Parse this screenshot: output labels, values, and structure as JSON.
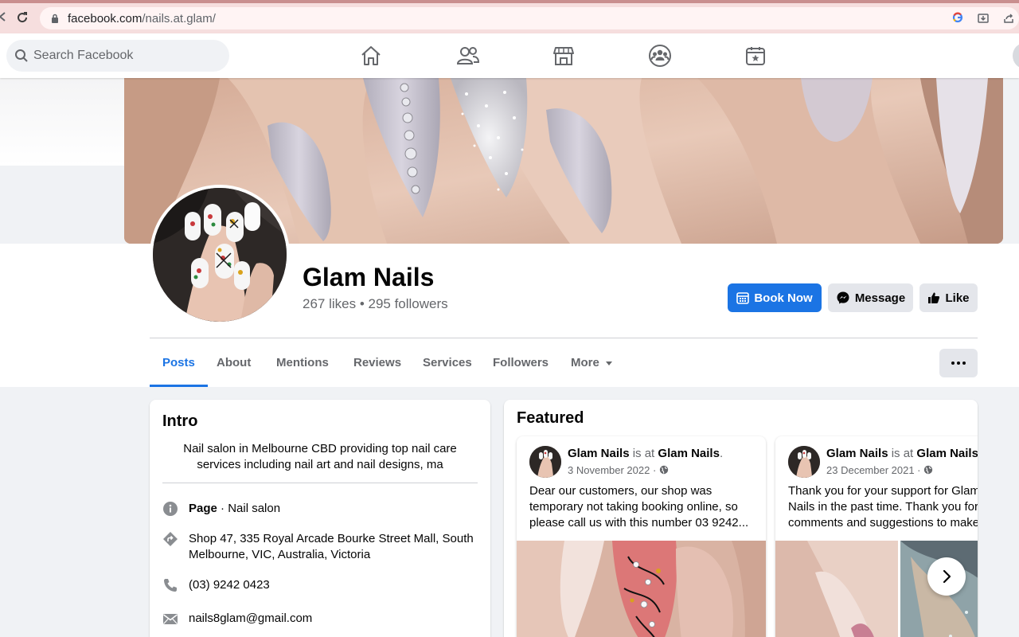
{
  "browser": {
    "url_domain": "facebook.com",
    "url_path": "/nails.at.glam/",
    "icons": [
      "back-arrow-icon",
      "reload-icon",
      "lock-icon",
      "google-icon",
      "install-icon",
      "share-icon"
    ]
  },
  "header": {
    "search_placeholder": "Search Facebook",
    "nav_icons": [
      "home-icon",
      "friends-icon",
      "marketplace-icon",
      "groups-icon",
      "gaming-icon"
    ]
  },
  "page": {
    "name": "Glam Nails",
    "stats": "267 likes • 295 followers",
    "buttons": {
      "book_now": "Book Now",
      "message": "Message",
      "like": "Like"
    },
    "tabs": [
      "Posts",
      "About",
      "Mentions",
      "Reviews",
      "Services",
      "Followers",
      "More"
    ],
    "active_tab": "Posts"
  },
  "intro": {
    "title": "Intro",
    "bio": "Nail salon in Melbourne CBD providing top nail care services including nail art and nail designs, ma",
    "category_label": "Page",
    "category_value": " · Nail salon",
    "address": "Shop 47, 335 Royal Arcade Bourke Street Mall, South Melbourne, VIC, Australia, Victoria",
    "phone": "(03) 9242 0423",
    "email": "nails8glam@gmail.com"
  },
  "featured": {
    "title": "Featured",
    "posts": [
      {
        "author": "Glam Nails",
        "connector": " is at ",
        "place": "Glam Nails",
        "period": ".",
        "date": "3 November 2022 ·",
        "line1": "Dear our customers, our shop was",
        "line2": "temporary not taking booking online, so",
        "line3": "please call us with this number 03 9242..."
      },
      {
        "author": "Glam Nails",
        "connector": " is at ",
        "place": "Glam Nails",
        "period": ".",
        "date": "23 December 2021 ·",
        "line1": "Thank you for your support for Glam",
        "line2": "Nails in the past time. Thank you for",
        "line3": "comments and suggestions to make"
      }
    ]
  },
  "colors": {
    "accent": "#1b74e4",
    "secondary_button": "#e4e6eb",
    "muted_text": "#65676b",
    "page_bg": "#f0f2f5"
  }
}
